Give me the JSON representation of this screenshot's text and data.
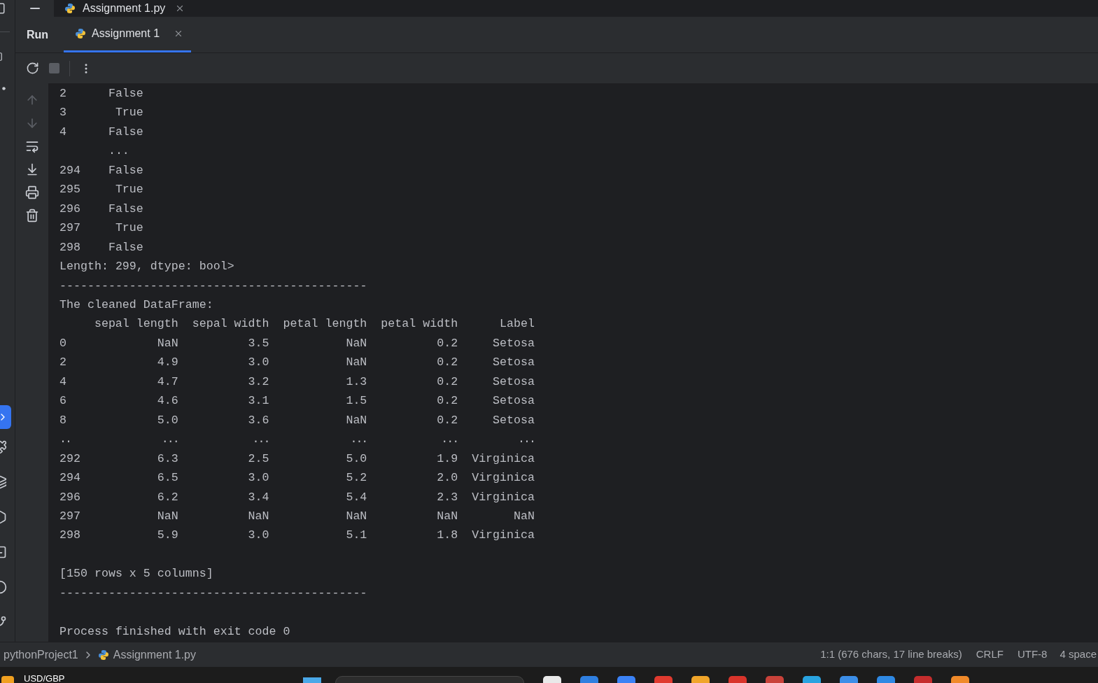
{
  "title_bar": {
    "tab": {
      "label": "Assignment 1.py"
    }
  },
  "run_panel": {
    "title": "Run",
    "tabs": [
      {
        "label": "Assignment 1",
        "selected": true
      }
    ]
  },
  "console": [
    {
      "kind": "series",
      "rows": [
        {
          "kind": "value",
          "index": "2",
          "value": "False"
        },
        {
          "kind": "value",
          "index": "3",
          "value": "True"
        },
        {
          "kind": "value",
          "index": "4",
          "value": "False"
        },
        {
          "kind": "ellipsis",
          "index": "",
          "value": "..."
        },
        {
          "kind": "value",
          "index": "294",
          "value": "False"
        },
        {
          "kind": "value",
          "index": "295",
          "value": "True"
        },
        {
          "kind": "value",
          "index": "296",
          "value": "False"
        },
        {
          "kind": "value",
          "index": "297",
          "value": "True"
        },
        {
          "kind": "value",
          "index": "298",
          "value": "False"
        }
      ]
    },
    {
      "kind": "text",
      "text": "Length: 299, dtype: bool>"
    },
    {
      "kind": "text",
      "text": "--------------------------------------------"
    },
    {
      "kind": "text",
      "text": "The cleaned DataFrame:"
    },
    {
      "kind": "table",
      "columns": [
        "sepal length",
        "sepal width",
        "petal length",
        "petal width",
        "Label"
      ],
      "rows": [
        {
          "index": "0",
          "cells": [
            "NaN",
            "3.5",
            "NaN",
            "0.2",
            "Setosa"
          ]
        },
        {
          "index": "2",
          "cells": [
            "4.9",
            "3.0",
            "NaN",
            "0.2",
            "Setosa"
          ]
        },
        {
          "index": "4",
          "cells": [
            "4.7",
            "3.2",
            "1.3",
            "0.2",
            "Setosa"
          ]
        },
        {
          "index": "6",
          "cells": [
            "4.6",
            "3.1",
            "1.5",
            "0.2",
            "Setosa"
          ]
        },
        {
          "index": "8",
          "cells": [
            "5.0",
            "3.6",
            "NaN",
            "0.2",
            "Setosa"
          ]
        },
        {
          "kind": "ellipsis",
          "index": "..",
          "cells": [
            "...",
            "...",
            "...",
            "...",
            "..."
          ]
        },
        {
          "index": "292",
          "cells": [
            "6.3",
            "2.5",
            "5.0",
            "1.9",
            "Virginica"
          ]
        },
        {
          "index": "294",
          "cells": [
            "6.5",
            "3.0",
            "5.2",
            "2.0",
            "Virginica"
          ]
        },
        {
          "index": "296",
          "cells": [
            "6.2",
            "3.4",
            "5.4",
            "2.3",
            "Virginica"
          ]
        },
        {
          "index": "297",
          "cells": [
            "NaN",
            "NaN",
            "NaN",
            "NaN",
            "NaN"
          ]
        },
        {
          "index": "298",
          "cells": [
            "5.9",
            "3.0",
            "5.1",
            "1.8",
            "Virginica"
          ]
        }
      ]
    },
    {
      "kind": "blank"
    },
    {
      "kind": "text",
      "text": "[150 rows x 5 columns]"
    },
    {
      "kind": "text",
      "text": "--------------------------------------------"
    },
    {
      "kind": "blank"
    },
    {
      "kind": "text",
      "text": "Process finished with exit code 0"
    }
  ],
  "status_bar": {
    "breadcrumbs": [
      "pythonProject1",
      "Assignment 1.py"
    ],
    "position": "1:1 (676 chars, 17 line breaks)",
    "line_separator": "CRLF",
    "encoding": "UTF-8",
    "indent": "4 space"
  },
  "taskbar": {
    "widget": "USD/GBP"
  }
}
